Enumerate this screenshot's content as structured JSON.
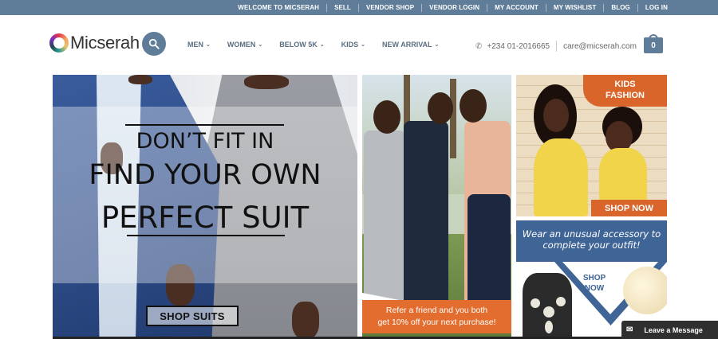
{
  "topbar": {
    "links": [
      "WELCOME TO MICSERAH",
      "SELL",
      "VENDOR SHOP",
      "VENDOR LOGIN",
      "MY ACCOUNT",
      "MY WISHLIST",
      "BLOG",
      "LOG IN"
    ]
  },
  "header": {
    "logo_text": "Micserah",
    "nav": [
      "MEN",
      "WOMEN",
      "BELOW 5K",
      "KIDS",
      "NEW ARRIVAL"
    ],
    "phone": "+234 01-2016665",
    "email": "care@micserah.com",
    "cart_count": "0"
  },
  "hero": {
    "line1": "DON’T FIT IN",
    "line2": "FIND YOUR OWN",
    "line3": "PERFECT SUIT",
    "button": "SHOP SUITS"
  },
  "middle": {
    "promo_line1": "Refer a friend and you both",
    "promo_line2": "get 10% off your next purchase!"
  },
  "kids": {
    "badge_line1": "KIDS",
    "badge_line2": "FASHION",
    "button": "SHOP NOW"
  },
  "accessory": {
    "line1": "Wear an unusual accessory to",
    "line2": "complete your outfit!",
    "shop_line1": "SHOP",
    "shop_line2": "NOW"
  },
  "chat": {
    "label": "Leave a Message"
  },
  "colors": {
    "brand": "#5f7d99",
    "orange": "#e36d2e",
    "accent_blue": "#3f6496"
  }
}
